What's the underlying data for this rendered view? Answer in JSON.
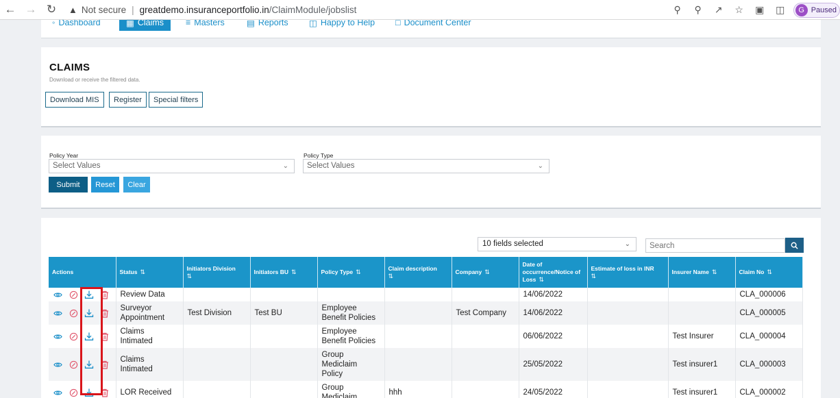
{
  "browser": {
    "security_label": "Not secure",
    "url_domain": "greatdemo.insuranceportfolio.in",
    "url_path": "/ClaimModule/jobslist",
    "profile_initial": "G",
    "profile_status": "Paused"
  },
  "appnav": {
    "items": [
      "Dashboard",
      "Claims",
      "Masters",
      "Reports",
      "Happy to Help",
      "Document Center"
    ]
  },
  "claims_card": {
    "title": "CLAIMS",
    "subtitle": "Download or receive the filtered data.",
    "buttons": [
      "Download MIS",
      "Register",
      "Special filters"
    ]
  },
  "filters": {
    "policy_year_label": "Policy Year",
    "policy_year_value": "Select Values",
    "policy_type_label": "Policy Type",
    "policy_type_value": "Select Values",
    "submit": "Submit",
    "reset": "Reset",
    "clear": "Clear"
  },
  "table_tools": {
    "fields_selected": "10 fields selected",
    "search_placeholder": "Search"
  },
  "table": {
    "headers": {
      "actions": "Actions",
      "status": "Status",
      "division": "Initiators Division",
      "bu": "Initiators BU",
      "policy_type": "Policy Type",
      "claim_description": "Claim description",
      "company": "Company",
      "date": "Date of occurrence/Notice of Loss",
      "estimate": "Estimate of loss in INR",
      "insurer": "Insurer Name",
      "claim_no": "Claim No"
    },
    "rows": [
      {
        "status": "Review Data",
        "division": "",
        "bu": "",
        "policy_type": "",
        "description": "",
        "company": "",
        "date": "14/06/2022",
        "estimate": "",
        "insurer": "",
        "claim_no": "CLA_000006"
      },
      {
        "status": "Surveyor Appointment",
        "division": "Test Division",
        "bu": "Test BU",
        "policy_type": "Employee Benefit Policies",
        "description": "",
        "company": "Test Company",
        "date": "14/06/2022",
        "estimate": "",
        "insurer": "",
        "claim_no": "CLA_000005"
      },
      {
        "status": "Claims Intimated",
        "division": "",
        "bu": "",
        "policy_type": "Employee Benefit Policies",
        "description": "",
        "company": "",
        "date": "06/06/2022",
        "estimate": "",
        "insurer": "Test Insurer",
        "claim_no": "CLA_000004"
      },
      {
        "status": "Claims Intimated",
        "division": "",
        "bu": "",
        "policy_type": "Group Mediclaim Policy",
        "description": "",
        "company": "",
        "date": "25/05/2022",
        "estimate": "",
        "insurer": "Test insurer1",
        "claim_no": "CLA_000003"
      },
      {
        "status": "LOR Received",
        "division": "",
        "bu": "",
        "policy_type": "Group Mediclaim",
        "description": "hhh",
        "company": "",
        "date": "24/05/2022",
        "estimate": "",
        "insurer": "Test insurer1",
        "claim_no": "CLA_000002"
      }
    ]
  },
  "colors": {
    "header_blue": "#1b95c9",
    "submit_navy": "#0d5e86",
    "reset_blue": "#2597d6",
    "clear_blue": "#3aa6e0",
    "highlight_red": "#d9151b"
  }
}
